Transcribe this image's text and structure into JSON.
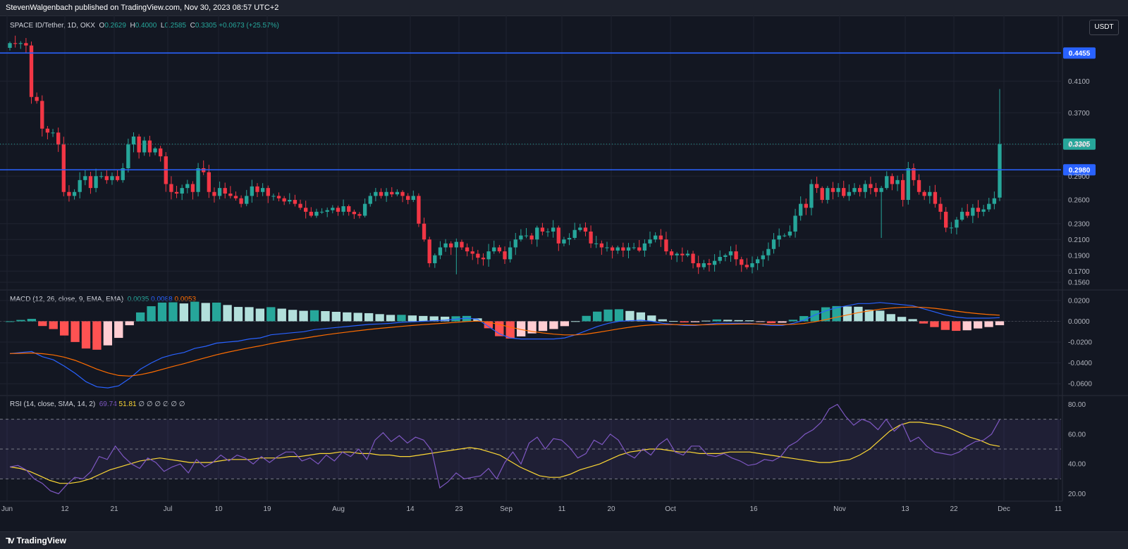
{
  "header": {
    "published": "StevenWalgenbach published on TradingView.com, Nov 30, 2023 08:57 UTC+2"
  },
  "footer": {
    "brand": "TradingView"
  },
  "price_pane": {
    "symbol": "SPACE ID/Tether, 1D, OKX",
    "o_label": "O",
    "o": "0.2629",
    "h_label": "H",
    "h": "0.4000",
    "l_label": "L",
    "l": "0.2585",
    "c_label": "C",
    "c": "0.3305",
    "change": "+0.0673 (+25.57%)",
    "currency_button": "USDT"
  },
  "macd_pane": {
    "label": "MACD (12, 26, close, 9, EMA, EMA)",
    "v1": "0.0035",
    "v2": "0.0088",
    "v3": "0.0053"
  },
  "rsi_pane": {
    "label": "RSI (14, close, SMA, 14, 2)",
    "v1": "69.74",
    "v2": "51.81",
    "extras": "∅ ∅ ∅ ∅ ∅ ∅"
  },
  "colors": {
    "up": "#26a69a",
    "down": "#f23645",
    "level": "#2962ff",
    "macd": "#2962ff",
    "signal": "#ff6d00",
    "rsi": "#7e57c2",
    "rsi_ma": "#fdd835",
    "bg": "#131722"
  },
  "chart_data": [
    {
      "type": "candlestick",
      "pane": "price",
      "ylim": [
        0.148,
        0.468
      ],
      "y_ticks": [
        "0.4100",
        "0.3700",
        "0.3300",
        "0.2900",
        "0.2600",
        "0.2300",
        "0.2100",
        "0.1900",
        "0.1700",
        "0.1560"
      ],
      "x_ticks": [
        "Jun",
        "12",
        "21",
        "Jul",
        "10",
        "19",
        "Aug",
        "14",
        "23",
        "Sep",
        "11",
        "20",
        "Oct",
        "16",
        "Nov",
        "13",
        "22",
        "Dec",
        "11"
      ],
      "horizontal_levels": [
        {
          "value": 0.4455,
          "label": "0.4455"
        },
        {
          "value": 0.298,
          "label": "0.2980"
        }
      ],
      "last_price": {
        "value": 0.3305,
        "label": "0.3305"
      },
      "closes": [
        0.458,
        0.457,
        0.458,
        0.455,
        0.39,
        0.385,
        0.35,
        0.345,
        0.345,
        0.33,
        0.27,
        0.265,
        0.27,
        0.285,
        0.29,
        0.275,
        0.29,
        0.29,
        0.285,
        0.29,
        0.285,
        0.3,
        0.33,
        0.34,
        0.32,
        0.335,
        0.32,
        0.325,
        0.315,
        0.28,
        0.27,
        0.268,
        0.275,
        0.28,
        0.27,
        0.3,
        0.295,
        0.27,
        0.265,
        0.275,
        0.268,
        0.265,
        0.262,
        0.255,
        0.265,
        0.277,
        0.27,
        0.275,
        0.265,
        0.265,
        0.262,
        0.258,
        0.26,
        0.255,
        0.25,
        0.245,
        0.24,
        0.245,
        0.245,
        0.247,
        0.25,
        0.245,
        0.252,
        0.245,
        0.242,
        0.24,
        0.255,
        0.265,
        0.27,
        0.265,
        0.27,
        0.267,
        0.27,
        0.265,
        0.26,
        0.265,
        0.23,
        0.21,
        0.18,
        0.19,
        0.2,
        0.205,
        0.2,
        0.207,
        0.2,
        0.195,
        0.192,
        0.187,
        0.185,
        0.195,
        0.2,
        0.195,
        0.185,
        0.2,
        0.21,
        0.215,
        0.215,
        0.21,
        0.225,
        0.22,
        0.22,
        0.225,
        0.205,
        0.21,
        0.212,
        0.222,
        0.225,
        0.22,
        0.205,
        0.205,
        0.2,
        0.2,
        0.196,
        0.2,
        0.196,
        0.2,
        0.2,
        0.196,
        0.205,
        0.21,
        0.215,
        0.21,
        0.195,
        0.19,
        0.192,
        0.19,
        0.192,
        0.18,
        0.175,
        0.18,
        0.178,
        0.183,
        0.188,
        0.19,
        0.195,
        0.185,
        0.178,
        0.175,
        0.18,
        0.185,
        0.19,
        0.198,
        0.21,
        0.215,
        0.215,
        0.22,
        0.24,
        0.255,
        0.25,
        0.28,
        0.275,
        0.26,
        0.275,
        0.27,
        0.275,
        0.265,
        0.27,
        0.275,
        0.27,
        0.28,
        0.275,
        0.27,
        0.275,
        0.29,
        0.28,
        0.285,
        0.26,
        0.3,
        0.285,
        0.27,
        0.265,
        0.27,
        0.255,
        0.245,
        0.225,
        0.225,
        0.235,
        0.245,
        0.24,
        0.25,
        0.245,
        0.248,
        0.255,
        0.262,
        0.3305
      ]
    },
    {
      "type": "macd",
      "pane": "macd",
      "ylim": [
        -0.07,
        0.026
      ],
      "y_ticks": [
        "0.0200",
        "0.0000",
        "-0.0200",
        "-0.0400",
        "-0.0600"
      ],
      "macd": [
        -0.031,
        -0.03,
        -0.029,
        -0.034,
        -0.037,
        -0.043,
        -0.05,
        -0.058,
        -0.063,
        -0.064,
        -0.062,
        -0.055,
        -0.046,
        -0.04,
        -0.035,
        -0.032,
        -0.03,
        -0.026,
        -0.024,
        -0.021,
        -0.02,
        -0.019,
        -0.017,
        -0.016,
        -0.013,
        -0.012,
        -0.011,
        -0.01,
        -0.008,
        -0.007,
        -0.006,
        -0.005,
        -0.004,
        -0.003,
        -0.0025,
        -0.002,
        -0.001,
        -0.0005,
        0.0,
        0.0005,
        0.001,
        0.002,
        0.003,
        0.002,
        -0.005,
        -0.012,
        -0.016,
        -0.017,
        -0.017,
        -0.017,
        -0.017,
        -0.016,
        -0.013,
        -0.009,
        -0.005,
        -0.002,
        0.0,
        0.0005,
        0.001,
        0.0,
        -0.002,
        -0.003,
        -0.004,
        -0.004,
        -0.003,
        -0.002,
        -0.002,
        -0.002,
        -0.002,
        -0.003,
        -0.004,
        -0.004,
        -0.002,
        0.001,
        0.006,
        0.01,
        0.013,
        0.015,
        0.017,
        0.017,
        0.018,
        0.017,
        0.016,
        0.015,
        0.012,
        0.009,
        0.006,
        0.004,
        0.003,
        0.003,
        0.003,
        0.0035
      ]
    },
    {
      "type": "line",
      "pane": "rsi",
      "ylim": [
        16,
        84
      ],
      "y_ticks": [
        "80.00",
        "60.00",
        "40.00",
        "20.00"
      ],
      "bands": {
        "upper": 70,
        "middle": 50,
        "lower": 30
      },
      "rsi": [
        38,
        39,
        36,
        30,
        27,
        22,
        20,
        26,
        31,
        30,
        35,
        45,
        43,
        52,
        45,
        40,
        37,
        44,
        41,
        35,
        38,
        40,
        34,
        43,
        38,
        41,
        46,
        42,
        46,
        44,
        40,
        45,
        41,
        45,
        48,
        48,
        42,
        44,
        40,
        46,
        42,
        48,
        45,
        50,
        43,
        56,
        61,
        55,
        59,
        54,
        58,
        56,
        49,
        24,
        28,
        34,
        30,
        31,
        32,
        37,
        30,
        41,
        48,
        40,
        54,
        58,
        50,
        57,
        56,
        51,
        44,
        47,
        56,
        53,
        60,
        56,
        47,
        44,
        50,
        46,
        53,
        57,
        48,
        46,
        52,
        52,
        46,
        45,
        47,
        44,
        42,
        39,
        40,
        43,
        42,
        45,
        52,
        55,
        60,
        63,
        68,
        77,
        80,
        72,
        66,
        70,
        68,
        63,
        70,
        62,
        67,
        55,
        58,
        52,
        48,
        47,
        46,
        48,
        52,
        55,
        56,
        60,
        69.74
      ],
      "rsi_ma": [
        38,
        37,
        35,
        32,
        29,
        27,
        27,
        28,
        30,
        33,
        36,
        38,
        40,
        42,
        43,
        44,
        43,
        42,
        41,
        41,
        41,
        42,
        43,
        43,
        43,
        44,
        44,
        44,
        45,
        45,
        46,
        47,
        47,
        48,
        48,
        47,
        47,
        46,
        46,
        45,
        45,
        46,
        47,
        48,
        49,
        50,
        51,
        50,
        48,
        46,
        42,
        38,
        35,
        32,
        31,
        31,
        33,
        36,
        38,
        40,
        43,
        46,
        48,
        49,
        50,
        50,
        49,
        48,
        48,
        47,
        47,
        47,
        48,
        48,
        48,
        47,
        46,
        45,
        44,
        43,
        42,
        41,
        41,
        42,
        43,
        46,
        50,
        56,
        62,
        66,
        68,
        68,
        67,
        66,
        64,
        61,
        58,
        56,
        53,
        51.81
      ]
    }
  ]
}
